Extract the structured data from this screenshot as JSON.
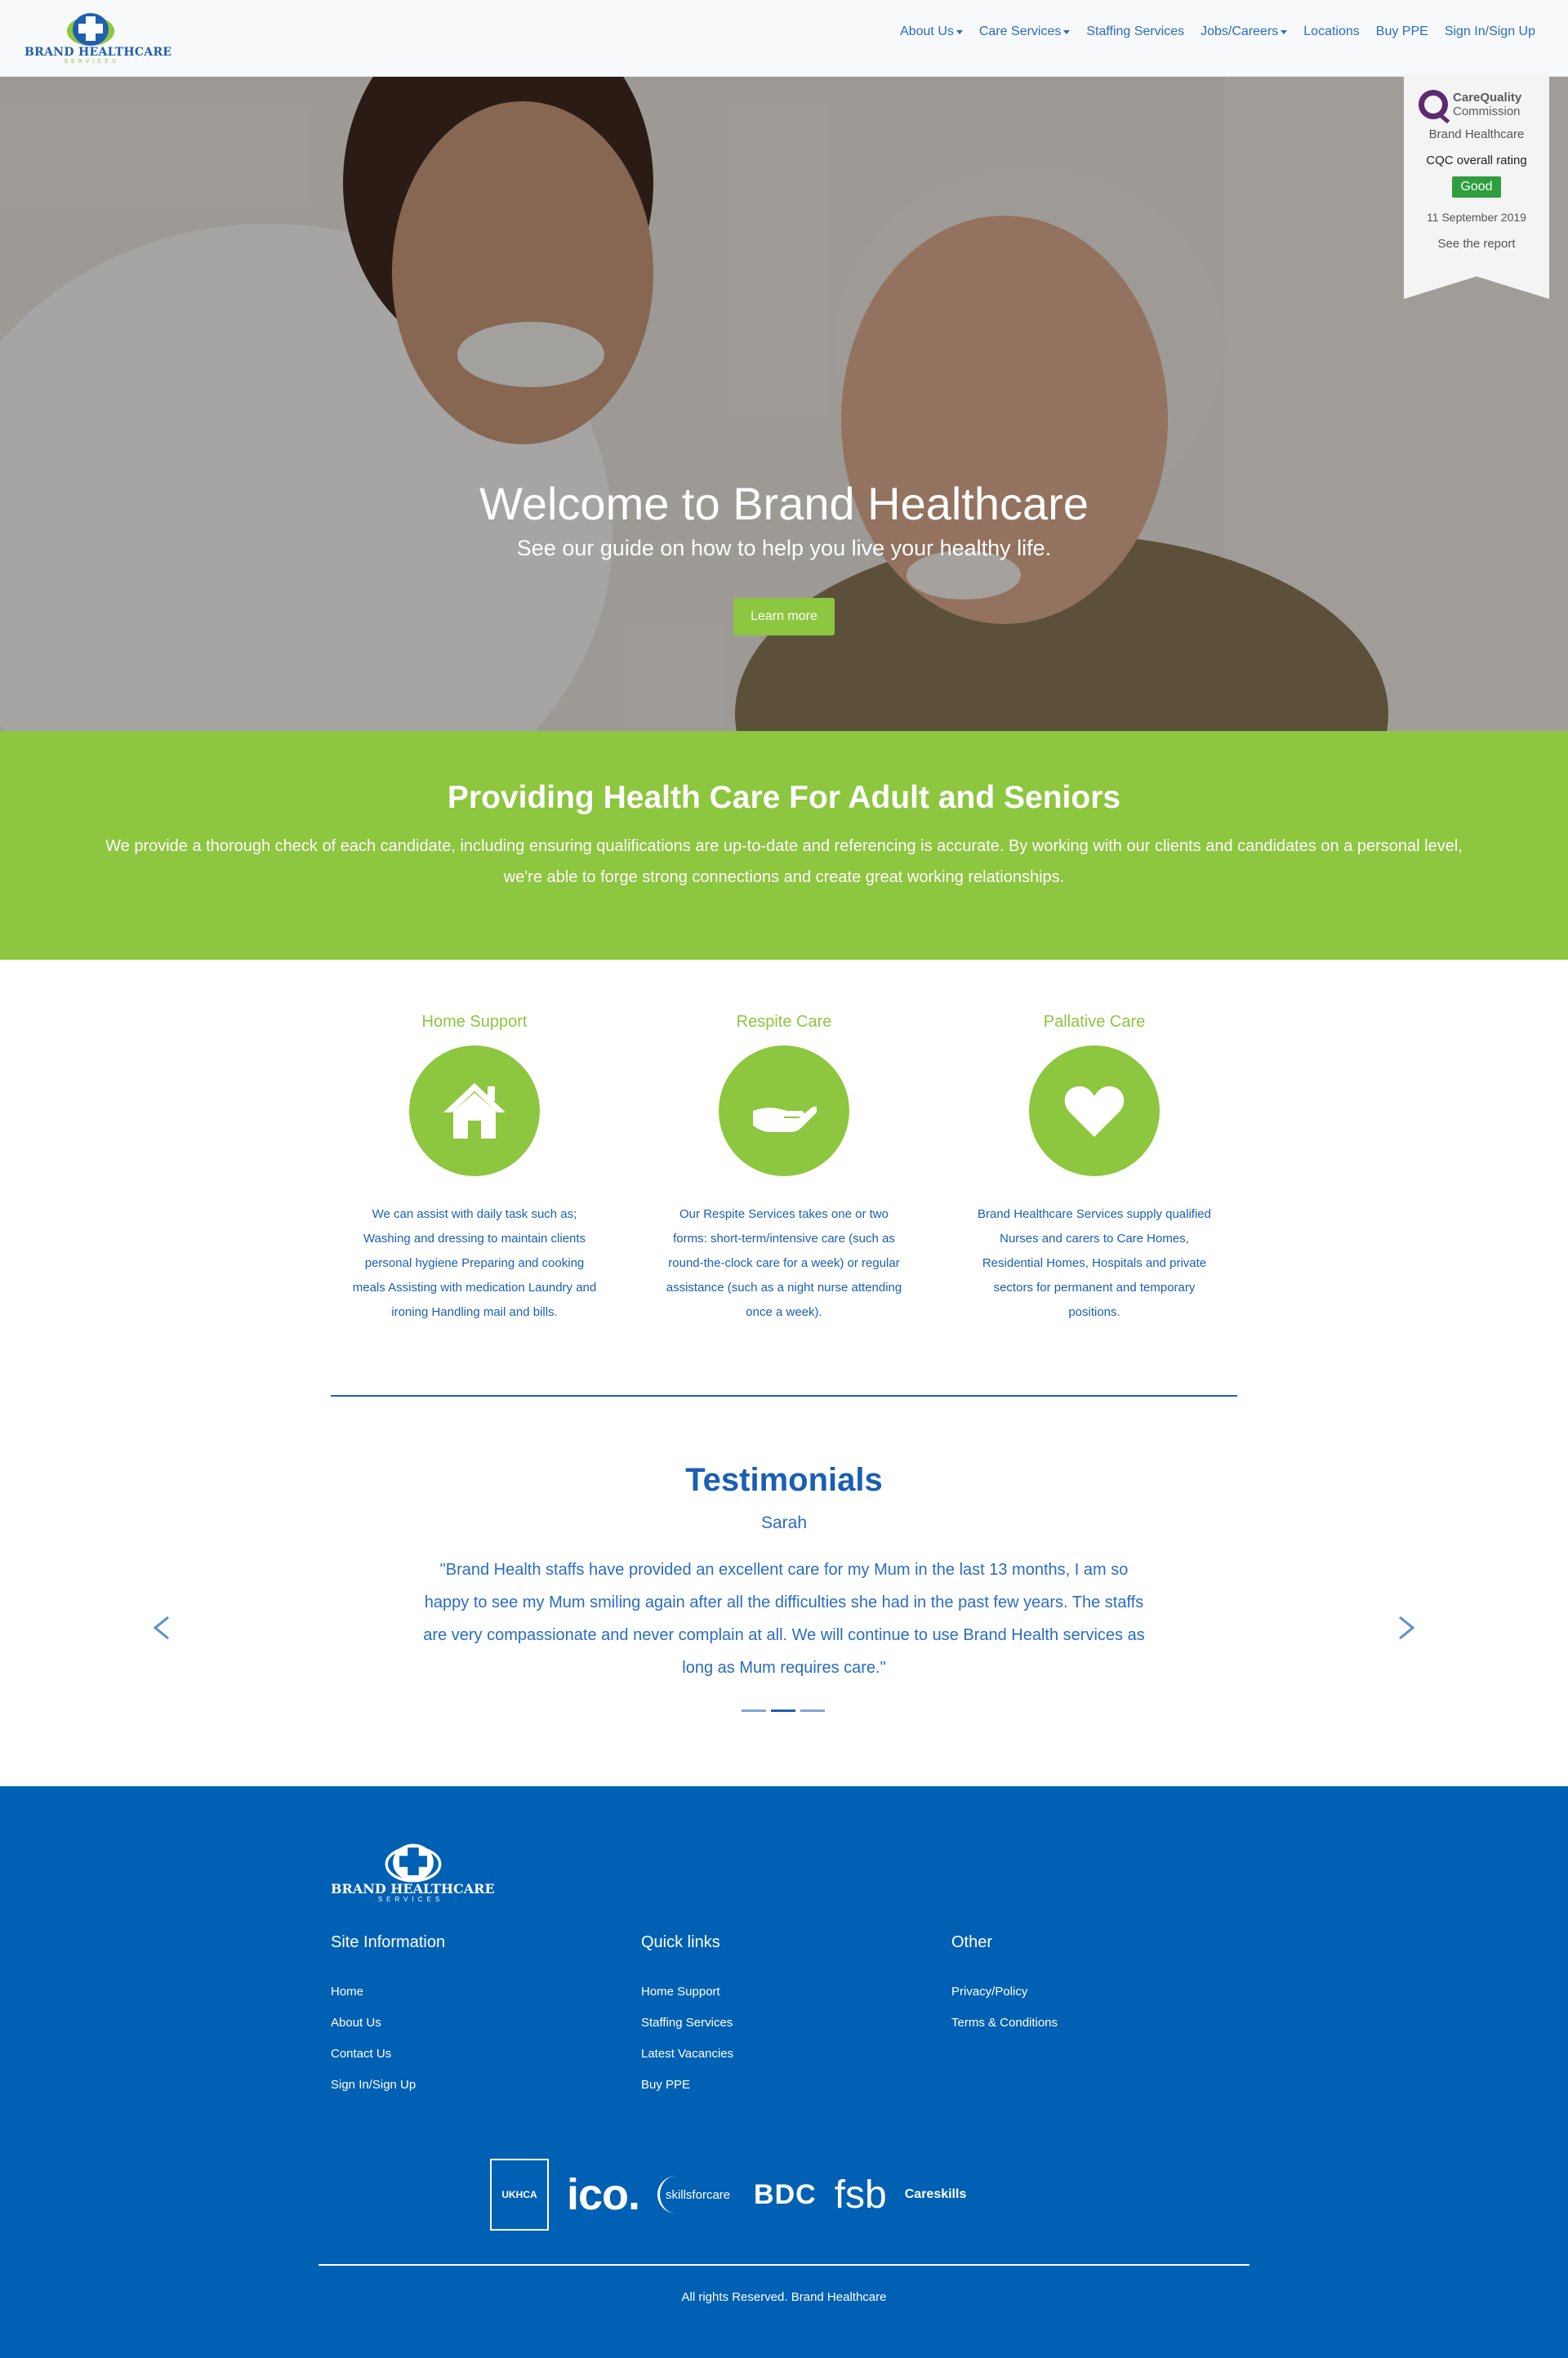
{
  "brand": {
    "name": "BRAND HEALTHCARE",
    "sub": "SERVICES"
  },
  "nav": {
    "items": [
      {
        "label": "About Us",
        "dropdown": true
      },
      {
        "label": "Care Services",
        "dropdown": true
      },
      {
        "label": "Staffing Services",
        "dropdown": false
      },
      {
        "label": "Jobs/Careers",
        "dropdown": true
      },
      {
        "label": "Locations",
        "dropdown": false
      },
      {
        "label": "Buy PPE",
        "dropdown": false
      },
      {
        "label": "Sign In/Sign Up",
        "dropdown": false
      }
    ]
  },
  "hero": {
    "title": "Welcome to Brand Healthcare",
    "subtitle": "See our guide on how to help you live your healthy life.",
    "button": "Learn more"
  },
  "cqc": {
    "logo_line1": "CareQuality",
    "logo_line2": "Commission",
    "provider": "Brand Healthcare",
    "label": "CQC overall rating",
    "rating": "Good",
    "date": "11 September 2019",
    "link": "See the report",
    "rating_color": "#2e9e3f"
  },
  "band": {
    "title": "Providing Health Care For Adult and Seniors",
    "text": "We provide a thorough check of each candidate, including ensuring qualifications are up-to-date and referencing is accurate. By working with our clients and candidates on a personal level, we're able to forge strong connections and create great working relationships."
  },
  "services": [
    {
      "title": "Home Support",
      "icon": "house-icon",
      "text": "We can assist with daily task such as; Washing and dressing to maintain clients personal hygiene Preparing and cooking meals Assisting with medication Laundry and ironing Handling mail and bills."
    },
    {
      "title": "Respite Care",
      "icon": "open-hand-icon",
      "text": "Our Respite Services takes one or two forms: short-term/intensive care (such as round-the-clock care for a week) or regular assistance (such as a night nurse attending once a week)."
    },
    {
      "title": "Pallative Care",
      "icon": "heart-icon",
      "text": "Brand Healthcare Services supply qualified Nurses and carers to Care Homes, Residential Homes, Hospitals and private sectors for permanent and temporary positions."
    }
  ],
  "testimonials": {
    "title": "Testimonials",
    "author": "Sarah",
    "quote": "\"Brand Health staffs have provided an excellent care for my Mum in the last 13 months, I am so happy to see my Mum smiling again after all the difficulties she had in the past few years. The staffs are very compassionate and never complain at all. We will continue to use Brand Health services as long as Mum requires care.\"",
    "slide_count": 3,
    "active_slide": 2
  },
  "footer": {
    "columns": [
      {
        "heading": "Site Information",
        "links": [
          "Home",
          "About Us",
          "Contact Us",
          "Sign In/Sign Up"
        ]
      },
      {
        "heading": "Quick links",
        "links": [
          "Home Support",
          "Staffing Services",
          "Latest Vacancies",
          "Buy PPE"
        ]
      },
      {
        "heading": "Other",
        "links": [
          "Privacy/Policy",
          "Terms & Conditions"
        ]
      }
    ],
    "partners": [
      "UKHCA",
      "ico.",
      "skillsforcare",
      "BDC",
      "fsb",
      "Careskills"
    ],
    "copyright": "All rights Reserved. Brand Healthcare"
  },
  "colors": {
    "primary_blue": "#0060b3",
    "link_blue": "#2a6cc1",
    "accent_green": "#8dc63f"
  }
}
